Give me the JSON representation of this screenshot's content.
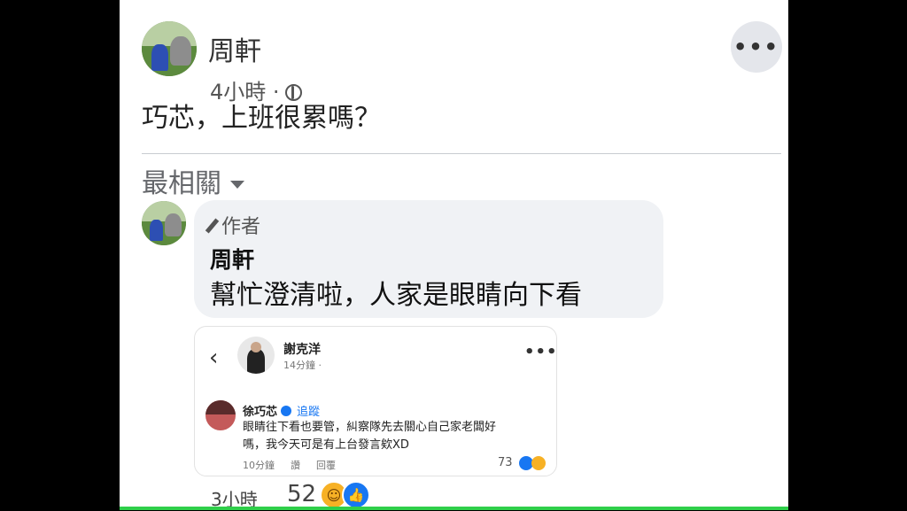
{
  "post": {
    "author": "周軒",
    "time": "4小時 ·",
    "text": "巧芯，上班很累嗎？",
    "more_icon": "more-horizontal-icon",
    "privacy_icon": "globe-icon"
  },
  "comments_section": {
    "sort_label": "最相關"
  },
  "comment": {
    "badge": "作者",
    "author": "周軒",
    "text": "幫忙澄清啦，人家是眼睛向下看",
    "time": "3小時",
    "reaction_count": "52"
  },
  "screenshot": {
    "poster_name": "謝克洋",
    "poster_time": "14分鐘 ·",
    "commenter_name": "徐巧芯",
    "follow_label": "追蹤",
    "comment_text": "眼睛往下看也要管，糾察隊先去關心自己家老闆好嗎，我今天可是有上台發言欸XD",
    "meta_time": "10分鐘",
    "meta_like": "讚",
    "meta_reply": "回覆",
    "reaction_count": "73"
  },
  "colors": {
    "accent": "#1877f2",
    "haha": "#f7b125",
    "bubble": "#f0f2f5"
  }
}
